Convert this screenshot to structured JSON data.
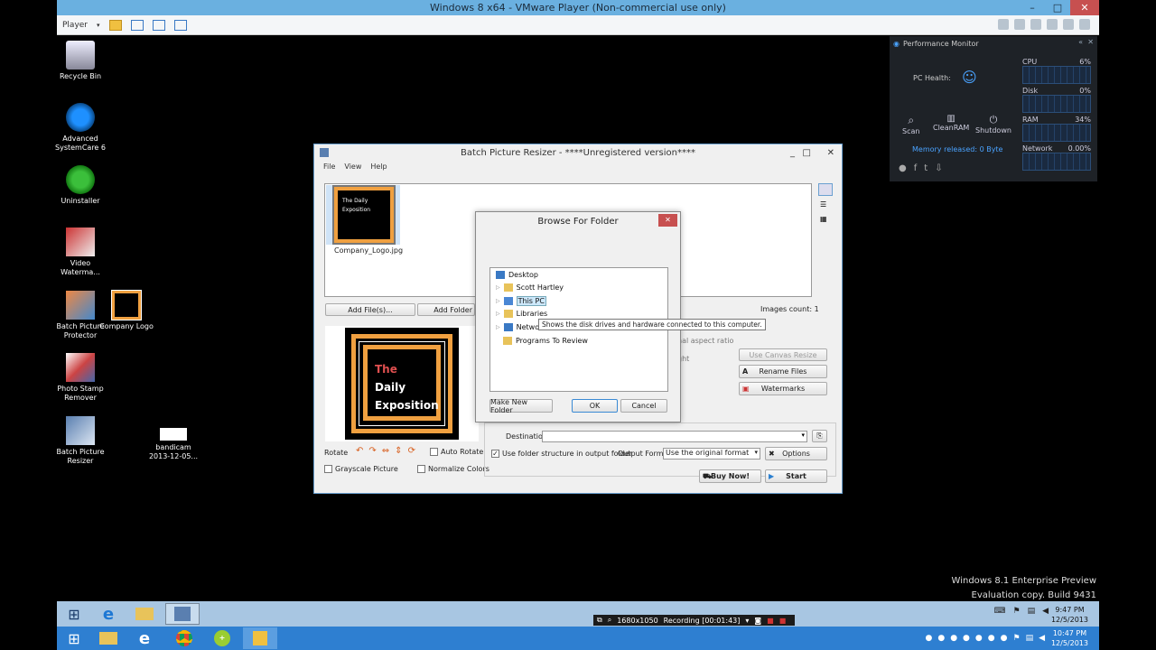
{
  "vm": {
    "title": "Windows 8 x64 - VMware Player (Non-commercial use only)",
    "player_menu": "Player",
    "ctrl_min": "–",
    "ctrl_max": "□",
    "ctrl_close": "✕"
  },
  "desktop_icons": [
    {
      "label": "Recycle Bin"
    },
    {
      "label": "Advanced SystemCare 6"
    },
    {
      "label": "Uninstaller"
    },
    {
      "label": "Video Waterma..."
    },
    {
      "label": "Batch Picture Protector"
    },
    {
      "label": "Company Logo"
    },
    {
      "label": "Photo Stamp Remover"
    },
    {
      "label": "Batch Picture Resizer"
    },
    {
      "label": "bandicam 2013-12-05..."
    }
  ],
  "perf": {
    "title": "Performance Monitor",
    "health_label": "PC Health:",
    "scan": "Scan",
    "cleanram": "CleanRAM",
    "shutdown": "Shutdown",
    "memory": "Memory released: 0 Byte",
    "cpu_label": "CPU",
    "cpu_val": "6%",
    "disk_label": "Disk",
    "disk_val": "0%",
    "ram_label": "RAM",
    "ram_val": "34%",
    "net_label": "Network",
    "net_val": "0.00%"
  },
  "bpr": {
    "title": "Batch Picture Resizer - ****Unregistered version****",
    "menu": [
      "File",
      "View",
      "Help"
    ],
    "thumb_caption": "Company_Logo.jpg",
    "thumb_text": "The Daily Exposition",
    "add_files": "Add File(s)...",
    "add_folder": "Add Folder",
    "images_count": "Images count: 1",
    "preview_title_1": "The",
    "preview_title_2": "Daily",
    "preview_title_3": "Exposition",
    "aspect_ratio": "nal aspect ratio",
    "ght": "ght",
    "use_canvas": "Use Canvas Resize",
    "rename": "Rename Files",
    "watermarks": "Watermarks",
    "rotate": "Rotate",
    "auto_rotate": "Auto Rotate",
    "grayscale": "Grayscale Picture",
    "normalize": "Normalize Colors",
    "destination_group": "Destination",
    "destination_label": "Destination",
    "use_folder_structure": "Use folder structure in output folder",
    "output_format_label": "Output Format",
    "output_format_value": "Use the original format",
    "options": "Options",
    "buy_now": "Buy Now!",
    "start": "Start"
  },
  "browse": {
    "title": "Browse For Folder",
    "tree": [
      "Desktop",
      "Scott Hartley",
      "This PC",
      "Libraries",
      "Networ",
      "Programs To Review"
    ],
    "tooltip": "Shows the disk drives and hardware connected to this computer.",
    "make_new_folder": "Make New Folder",
    "ok": "OK",
    "cancel": "Cancel"
  },
  "watermark": {
    "line1": "Windows 8.1 Enterprise Preview",
    "line2": "Evaluation copy. Build 9431"
  },
  "recorder": {
    "resolution": "1680x1050",
    "status": "Recording [00:01:43]"
  },
  "inner_clock": {
    "time": "9:47 PM",
    "date": "12/5/2013"
  },
  "outer_clock": {
    "time": "10:47 PM",
    "date": "12/5/2013"
  }
}
